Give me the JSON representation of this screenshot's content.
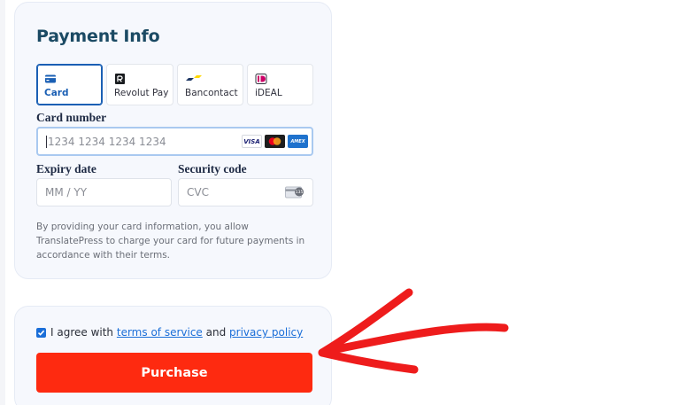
{
  "payment": {
    "title": "Payment Info",
    "tabs": [
      {
        "label": "Card",
        "icon": "credit-card-icon",
        "selected": true
      },
      {
        "label": "Revolut Pay",
        "icon": "revolut-icon",
        "selected": false
      },
      {
        "label": "Bancontact",
        "icon": "bancontact-icon",
        "selected": false
      },
      {
        "label": "iDEAL",
        "icon": "ideal-icon",
        "selected": false
      }
    ],
    "card_number": {
      "label": "Card number",
      "placeholder": "1234 1234 1234 1234"
    },
    "card_brands": [
      "VISA",
      "MC",
      "AMEX"
    ],
    "expiry": {
      "label": "Expiry date",
      "placeholder": "MM / YY"
    },
    "security": {
      "label": "Security code",
      "placeholder": "CVC",
      "badge": "135"
    },
    "disclaimer": "By providing your card information, you allow TranslatePress to charge your card for future payments in accordance with their terms."
  },
  "agreement": {
    "prefix": "I agree with",
    "terms_link": "terms of service",
    "middle": "and",
    "privacy_link": "privacy policy",
    "checked": true
  },
  "purchase_label": "Purchase",
  "colors": {
    "accent": "#1a5fb4",
    "title": "#1b4a64",
    "button": "#fe2a10",
    "arrow": "#ee1c1c",
    "panel": "#f6f8fd"
  }
}
